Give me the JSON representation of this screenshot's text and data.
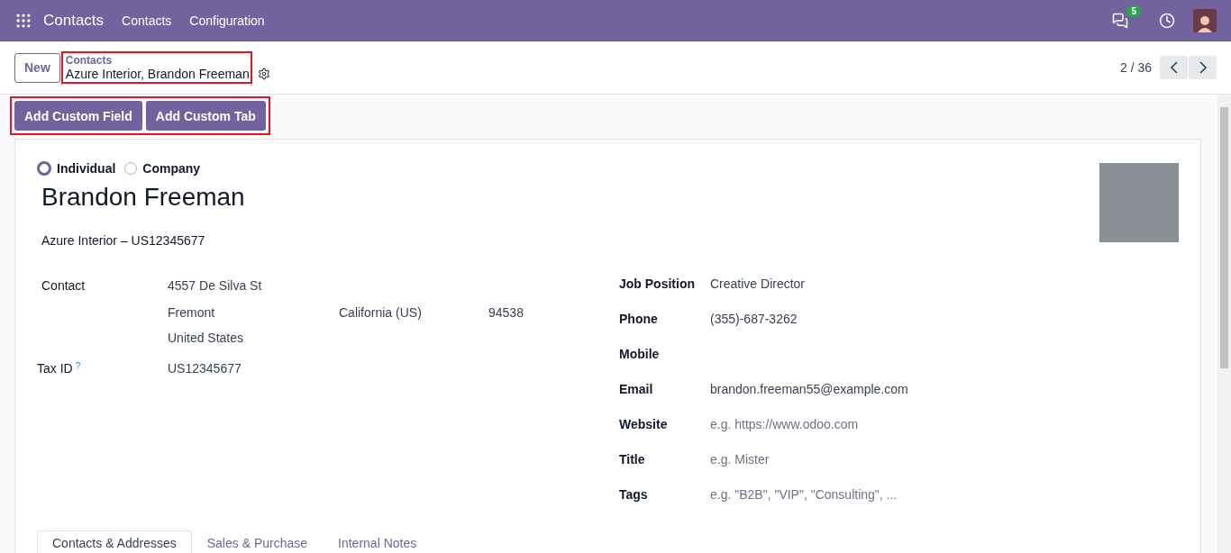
{
  "navbar": {
    "app": "Contacts",
    "menu": [
      "Contacts",
      "Configuration"
    ],
    "messages_count": "5"
  },
  "control_panel": {
    "new_button": "New",
    "breadcrumb": "Contacts",
    "record": "Azure Interior, Brandon Freeman",
    "pager": "2 / 36"
  },
  "actions": [
    "Add Custom Field",
    "Add Custom Tab"
  ],
  "form": {
    "type_options": [
      {
        "label": "Individual",
        "selected": true
      },
      {
        "label": "Company",
        "selected": false
      }
    ],
    "name": "Brandon Freeman",
    "company": "Azure Interior – US12345677",
    "address": {
      "label": "Contact",
      "street": "4557 De Silva St",
      "city": "Fremont",
      "state": "California (US)",
      "zip": "94538",
      "country": "United States"
    },
    "tax": {
      "label": "Tax ID",
      "help": "?",
      "value": "US12345677"
    },
    "right_fields": [
      {
        "label": "Job Position",
        "value": "Creative Director"
      },
      {
        "label": "Phone",
        "value": "(355)-687-3262"
      },
      {
        "label": "Mobile"
      },
      {
        "label": "Email",
        "value": "brandon.freeman55@example.com"
      },
      {
        "label": "Website",
        "placeholder": "e.g. https://www.odoo.com"
      },
      {
        "label": "Title",
        "placeholder": "e.g. Mister"
      },
      {
        "label": "Tags",
        "placeholder": "e.g. \"B2B\", \"VIP\", \"Consulting\", ..."
      }
    ],
    "tabs": [
      {
        "label": "Contacts & Addresses",
        "selected": true
      },
      {
        "label": "Sales & Purchase",
        "selected": false
      },
      {
        "label": "Internal Notes",
        "selected": false
      }
    ]
  }
}
